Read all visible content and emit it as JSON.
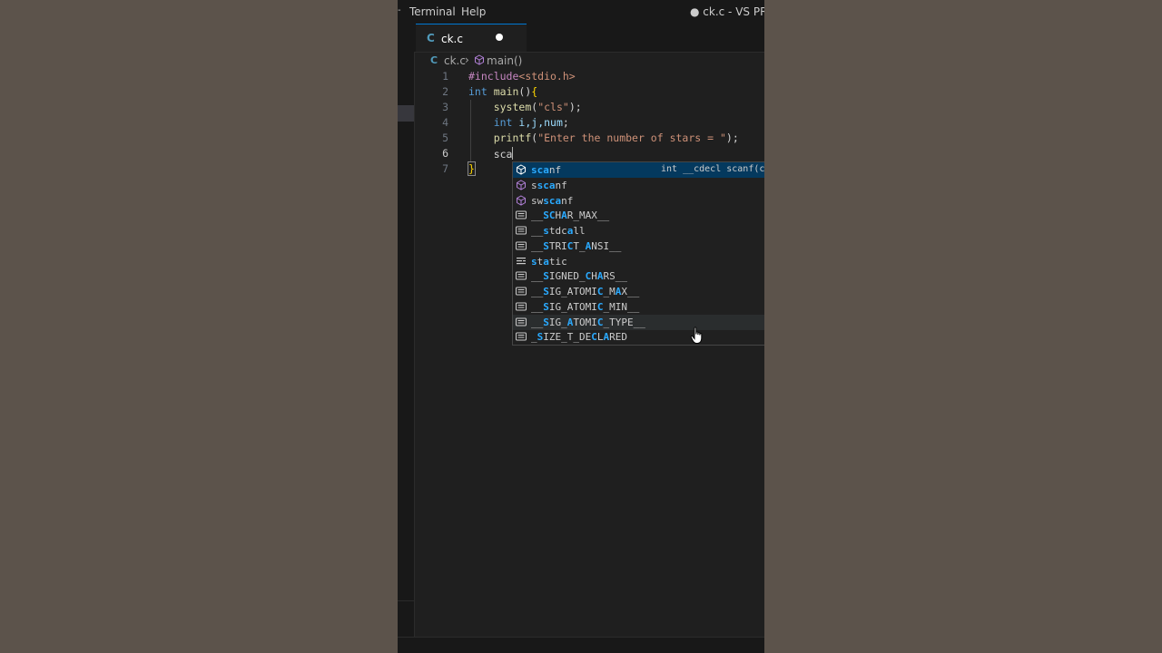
{
  "menubar": {
    "overflow_icon": "menu-overflow-arrow",
    "items": [
      "Terminal",
      "Help"
    ],
    "window_title": "● ck.c - VS PROG"
  },
  "tab": {
    "language_icon": "C",
    "label": "ck.c",
    "dirty_indicator": "unsaved-dot"
  },
  "breadcrumb": {
    "language_icon": "C",
    "file": "ck.c",
    "separator": "›",
    "symbol_icon": "cube-icon",
    "symbol": "main()"
  },
  "editor": {
    "line_numbers": [
      "1",
      "2",
      "3",
      "4",
      "5",
      "6",
      "7"
    ],
    "active_line": "6",
    "tokens": {
      "l1_pp": "#include",
      "l1_inc": "<stdio.h>",
      "l2_kw": "int",
      "l2_fn": "main",
      "l2_paren": "()",
      "l2_brace": "{",
      "l3_fn": "system",
      "l3_open": "(",
      "l3_str": "\"cls\"",
      "l3_close": ");",
      "l4_kw": "int",
      "l4_vars": "i,j,num",
      "l4_semi": ";",
      "l5_fn": "printf",
      "l5_open": "(",
      "l5_str": "\"Enter the number of stars = \"",
      "l5_close": ");",
      "l6_typed": "sca",
      "l7_brace": "}"
    }
  },
  "suggestions": {
    "focused_index": 0,
    "hover_index": 10,
    "focused_detail": "int __cdecl scanf(co",
    "items": [
      {
        "icon": "method-cube-icon",
        "pre": "",
        "hl": "sca",
        "post": "nf"
      },
      {
        "icon": "method-cube-icon",
        "pre": "s",
        "hl": "sca",
        "post": "nf"
      },
      {
        "icon": "method-cube-icon",
        "pre": "sw",
        "hl": "sca",
        "post": "nf"
      },
      {
        "icon": "text-snippet-icon",
        "pre": "__",
        "hl": "SC",
        "post": "H",
        "hl2": "A",
        "post2": "R_MAX__"
      },
      {
        "icon": "text-snippet-icon",
        "pre": "__",
        "hl": "s",
        "post": "tdc",
        "hl2": "a",
        "post2": "ll"
      },
      {
        "icon": "text-snippet-icon",
        "pre": "__",
        "hl": "S",
        "post": "TRI",
        "hl2": "C",
        "post2": "T_",
        "hl3": "A",
        "post3": "NSI__"
      },
      {
        "icon": "keyword-icon",
        "pre": "",
        "hl": "s",
        "post": "t",
        "hl2": "a",
        "post2": "tic"
      },
      {
        "icon": "text-snippet-icon",
        "pre": "__",
        "hl": "S",
        "post": "IGNED_",
        "hl2": "C",
        "post2": "H",
        "hl3": "A",
        "post3": "RS__"
      },
      {
        "icon": "text-snippet-icon",
        "pre": "__",
        "hl": "S",
        "post": "IG_ATOMI",
        "hl2": "C",
        "post2": "_M",
        "hl3": "A",
        "post3": "X__"
      },
      {
        "icon": "text-snippet-icon",
        "pre": "__",
        "hl": "S",
        "post": "IG_ATOMI",
        "hl2": "C",
        "post2": "_MIN__"
      },
      {
        "icon": "text-snippet-icon",
        "pre": "__",
        "hl": "S",
        "post": "IG_",
        "hl2": "A",
        "post2": "TOMI",
        "hl3": "C",
        "post3": "_TYPE__"
      },
      {
        "icon": "text-snippet-icon",
        "pre": "_",
        "hl": "S",
        "post": "IZE_T_DE",
        "hl2": "C",
        "post2": "L",
        "hl3": "A",
        "post3": "RED"
      }
    ]
  },
  "colors": {
    "accent": "#0078d4",
    "highlight": "#2aaaff",
    "method_icon": "#b180d7"
  }
}
